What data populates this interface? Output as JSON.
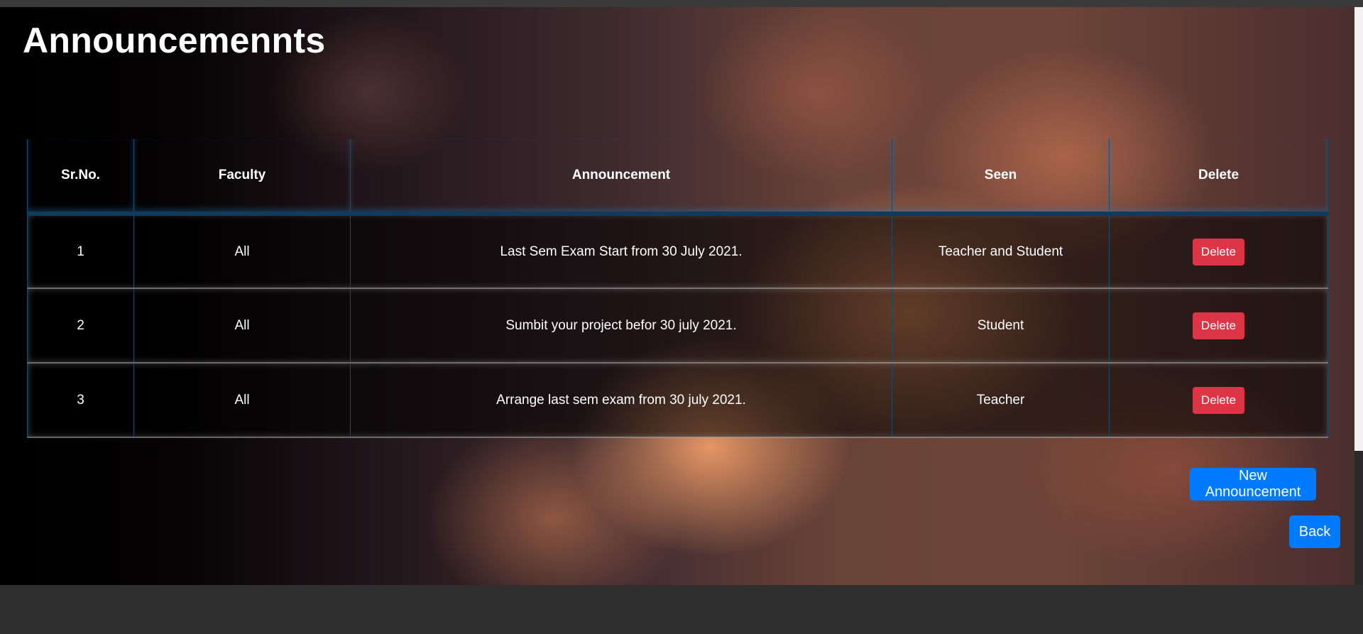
{
  "page": {
    "title": "Announcemennts"
  },
  "table": {
    "headers": [
      "Sr.No.",
      "Faculty",
      "Announcement",
      "Seen",
      "Delete"
    ],
    "rows": [
      {
        "sr": "1",
        "faculty": "All",
        "announcement": "Last Sem Exam Start from 30 July 2021.",
        "seen": "Teacher and Student",
        "delete_label": "Delete"
      },
      {
        "sr": "2",
        "faculty": "All",
        "announcement": "Sumbit your project befor 30 july 2021.",
        "seen": "Student",
        "delete_label": "Delete"
      },
      {
        "sr": "3",
        "faculty": "All",
        "announcement": "Arrange last sem exam from 30 july 2021.",
        "seen": "Teacher",
        "delete_label": "Delete"
      }
    ]
  },
  "actions": {
    "new_label": "New Announcement",
    "back_label": "Back"
  },
  "colors": {
    "primary": "#007bff",
    "danger": "#dc3545",
    "text": "#ffffff"
  }
}
